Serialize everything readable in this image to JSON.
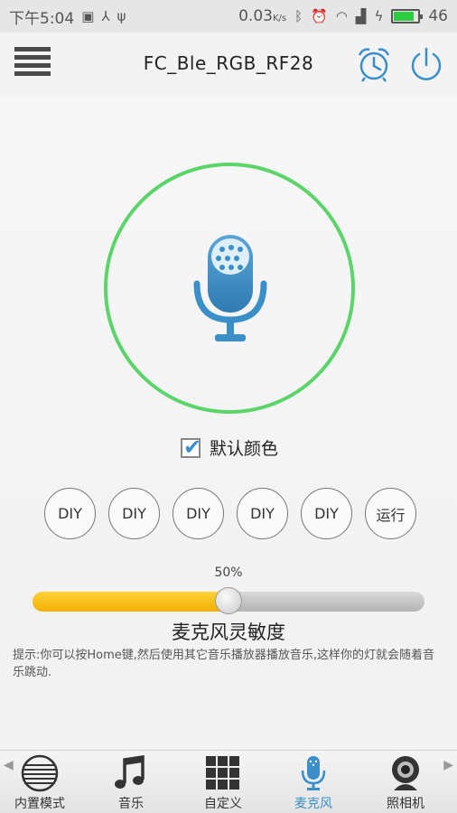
{
  "status_bar": {
    "time": "下午5:04",
    "net_speed": "0.03",
    "net_unit": "K/s",
    "network_type": "46",
    "battery_level": 0.85,
    "icons": [
      "image-icon",
      "usb-icon",
      "debug-icon",
      "bluetooth-icon",
      "alarm-icon",
      "wifi-icon",
      "signal-icon",
      "charging-icon",
      "battery-icon"
    ]
  },
  "header": {
    "title": "FC_Ble_RGB_RF28",
    "icons": [
      "menu-icon",
      "alarm-clock-icon",
      "power-icon"
    ]
  },
  "mic_panel": {
    "icon": "microphone-icon",
    "ring_color": "#5bd46a"
  },
  "default_color": {
    "label": "默认颜色",
    "checked": true
  },
  "diy_buttons": [
    "DIY",
    "DIY",
    "DIY",
    "DIY",
    "DIY",
    "运行"
  ],
  "sensitivity": {
    "value_text": "50%",
    "value": 0.5,
    "label": "麦克风灵敏度",
    "fill_color": "#f5b800"
  },
  "hint": "提示:你可以按Home键,然后使用其它音乐播放器播放音乐,这样你的灯就会随着音乐跳动.",
  "bottom_nav": {
    "items": [
      {
        "label": "内置模式",
        "icon": "sphere-icon"
      },
      {
        "label": "音乐",
        "icon": "music-note-icon"
      },
      {
        "label": "自定义",
        "icon": "grid-icon"
      },
      {
        "label": "麦克风",
        "icon": "microphone-icon",
        "active": true
      },
      {
        "label": "照相机",
        "icon": "webcam-icon"
      }
    ],
    "arrows": [
      "left-arrow-icon",
      "right-arrow-icon"
    ]
  },
  "colors": {
    "accent": "#3a8fc9",
    "ring": "#5bd46a",
    "slider": "#f5b800"
  }
}
